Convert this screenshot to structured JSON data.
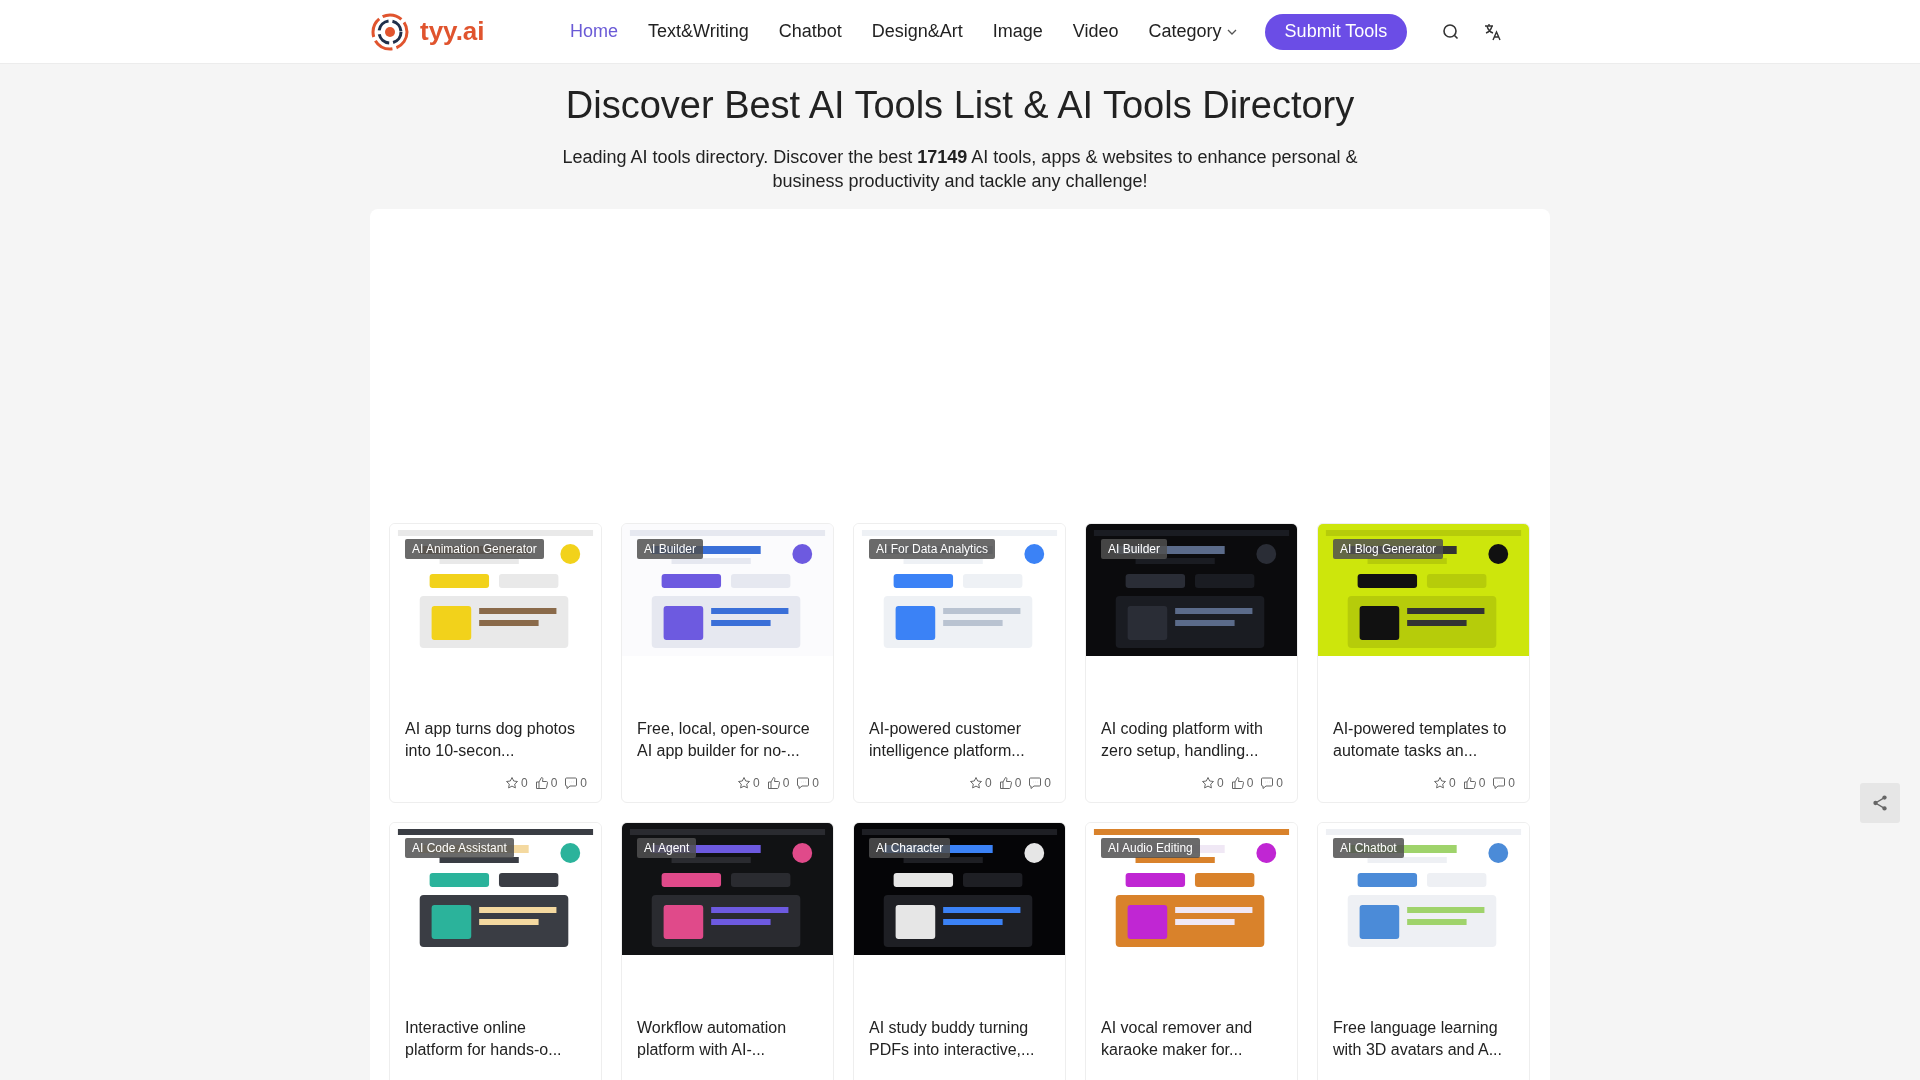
{
  "header": {
    "logo": "tyy.ai",
    "nav": [
      {
        "label": "Home",
        "selected": true
      },
      {
        "label": "Text&Writing",
        "selected": false
      },
      {
        "label": "Chatbot",
        "selected": false
      },
      {
        "label": "Design&Art",
        "selected": false
      },
      {
        "label": "Image",
        "selected": false
      },
      {
        "label": "Video",
        "selected": false
      },
      {
        "label": "Category",
        "selected": false,
        "dropdown": true
      }
    ],
    "submit_button": "Submit Tools"
  },
  "hero": {
    "title": "Discover Best AI Tools List & AI Tools Directory",
    "subtitle": "Leading AI tools directory. Discover the best **17149** AI tools, apps & websites to enhance personal & business productivity and tackle any challenge!"
  },
  "cards": [
    {
      "tag": "AI Animation Generator",
      "description": "AI app turns dog photos into 10-secon...",
      "favorites": "0",
      "likes": "0",
      "comments": "0"
    },
    {
      "tag": "AI Builder",
      "description": "Free, local, open-source AI app builder for no-...",
      "favorites": "0",
      "likes": "0",
      "comments": "0"
    },
    {
      "tag": "AI For Data Analytics",
      "description": "AI-powered customer intelligence platform...",
      "favorites": "0",
      "likes": "0",
      "comments": "0"
    },
    {
      "tag": "AI Builder",
      "description": "AI coding platform with zero setup, handling...",
      "favorites": "0",
      "likes": "0",
      "comments": "0"
    },
    {
      "tag": "AI Blog Generator",
      "description": "AI-powered templates to automate tasks an...",
      "favorites": "0",
      "likes": "0",
      "comments": "0"
    },
    {
      "tag": "AI Code Assistant",
      "description": "Interactive online platform for hands-o..."
    },
    {
      "tag": "AI Agent",
      "description": "Workflow automation platform with AI-..."
    },
    {
      "tag": "AI Character",
      "description": "AI study buddy turning PDFs into interactive,..."
    },
    {
      "tag": "AI Audio Editing",
      "description": "AI vocal remover and karaoke maker for..."
    },
    {
      "tag": "AI Chatbot",
      "description": "Free language learning with 3D avatars and A..."
    }
  ]
}
